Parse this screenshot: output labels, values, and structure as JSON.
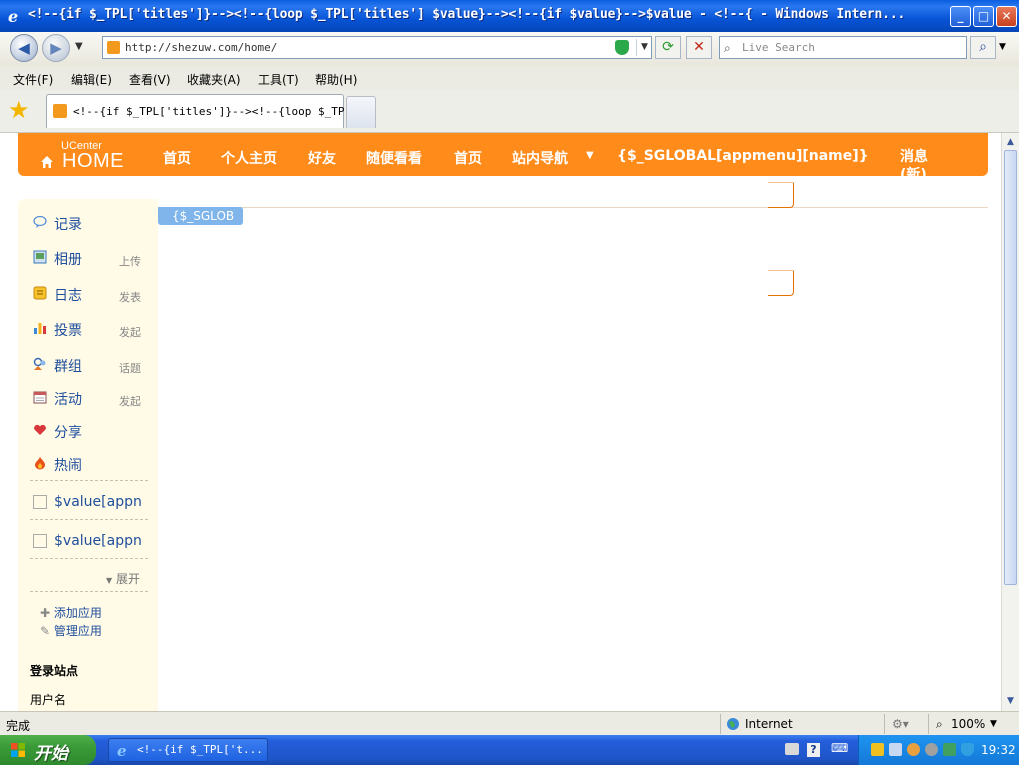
{
  "window": {
    "title": "<!--{if $_TPL['titles']}--><!--{loop $_TPL['titles'] $value}--><!--{if $value}-->$value - <!--{ - Windows Intern...",
    "min_label": "_",
    "max_label": "□",
    "close_label": "✕"
  },
  "browser": {
    "url": "http://shezuw.com/home/",
    "search_placeholder": "Live Search",
    "tab_title": "<!--{if $_TPL['titles']}--><!--{loop $_TP..."
  },
  "menu": [
    "文件(F)",
    "编辑(E)",
    "查看(V)",
    "收藏夹(A)",
    "工具(T)",
    "帮助(H)"
  ],
  "site": {
    "logo_small": "UCenter",
    "logo_big": "HOME",
    "nav": [
      "首页",
      "个人主页",
      "好友",
      "随便看看",
      "首页",
      "站内导航",
      "{$_SGLOBAL[appmenu][name]}",
      "消息(新)"
    ],
    "badge": "{$_SGLOB",
    "sidebar": {
      "items": [
        {
          "label": "记录",
          "sub": "",
          "icon": "speech-bubble-icon"
        },
        {
          "label": "相册",
          "sub": "上传",
          "icon": "photo-icon"
        },
        {
          "label": "日志",
          "sub": "发表",
          "icon": "notebook-icon"
        },
        {
          "label": "投票",
          "sub": "发起",
          "icon": "bar-chart-icon"
        },
        {
          "label": "群组",
          "sub": "话题",
          "icon": "group-icon"
        },
        {
          "label": "活动",
          "sub": "发起",
          "icon": "calendar-icon"
        },
        {
          "label": "分享",
          "sub": "",
          "icon": "heart-icon"
        },
        {
          "label": "热闹",
          "sub": "",
          "icon": "fire-icon"
        }
      ],
      "apps": [
        "$value[appn",
        "$value[appn"
      ],
      "expand_label": "展开",
      "add_app": "添加应用",
      "manage_app": "管理应用",
      "login_title": "登录站点",
      "username_label": "用户名"
    }
  },
  "status": {
    "left": "完成",
    "zone": "Internet",
    "zoom": "100%"
  },
  "taskbar": {
    "start": "开始",
    "task": "<!--{if $_TPL['t...",
    "clock": "19:32"
  },
  "colors": {
    "nav_orange": "#ff8b1a",
    "sidebar_bg": "#fffbe7",
    "link_blue": "#1f4e9c",
    "xp_blue": "#245edb"
  }
}
